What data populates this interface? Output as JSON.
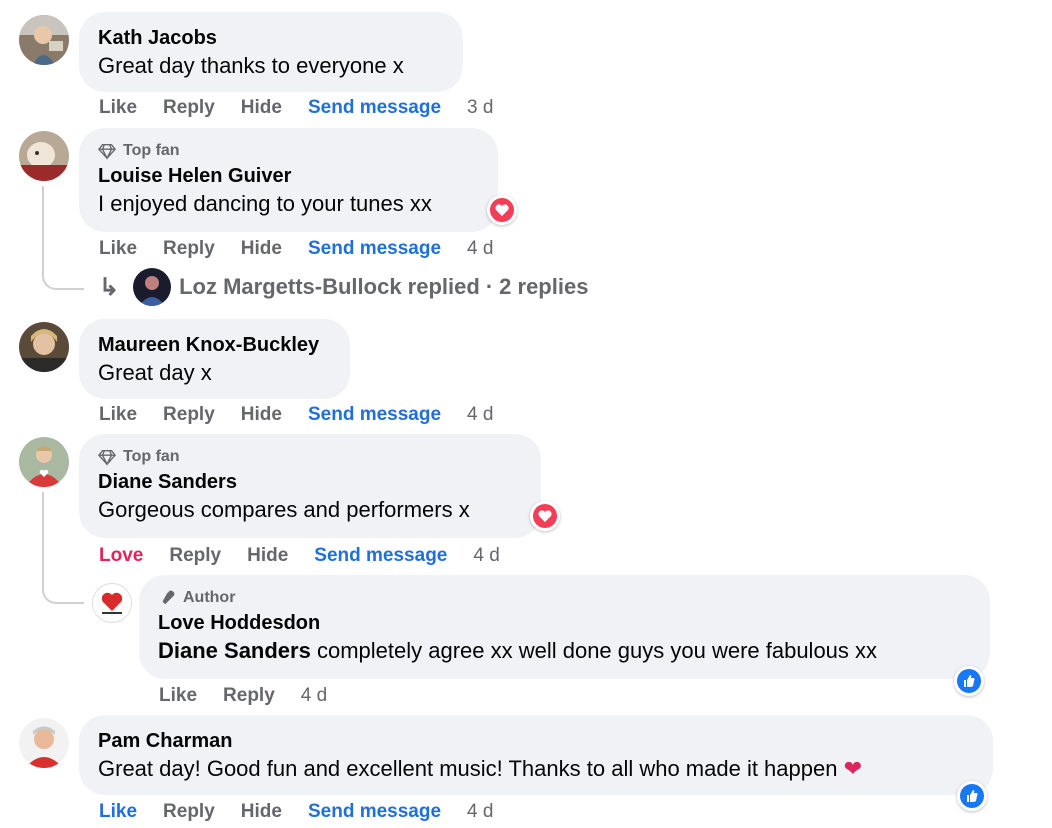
{
  "actions": {
    "like": "Like",
    "love": "Love",
    "reply": "Reply",
    "hide": "Hide",
    "send": "Send message"
  },
  "comments": [
    {
      "name": "Kath Jacobs",
      "text": "Great day thanks to everyone x",
      "time": "3 d"
    },
    {
      "badge": "Top fan",
      "name": "Louise Helen Guiver",
      "text": "I enjoyed dancing to your tunes xx",
      "time": "4 d",
      "replies_row": {
        "name": "Loz Margetts-Bullock replied",
        "sep": "·",
        "count": "2 replies"
      }
    },
    {
      "name": "Maureen Knox-Buckley",
      "text": "Great day x",
      "time": "4 d"
    },
    {
      "badge": "Top fan",
      "name": "Diane Sanders",
      "text": "Gorgeous compares and performers x",
      "time": "4 d",
      "reaction": "Love"
    },
    {
      "badge": "Author",
      "name": "Love Hoddesdon",
      "mention": "Diane Sanders",
      "text": " completely agree xx well done guys you were fabulous xx",
      "time": "4 d"
    },
    {
      "name": "Pam Charman",
      "text": "Great day! Good fun and excellent music! Thanks to all who made it happen",
      "time": "4 d"
    }
  ],
  "colors": {
    "bubble": "#f0f2f5",
    "link": "#216fdb",
    "love": "#e0245e",
    "muted": "#65676b"
  }
}
